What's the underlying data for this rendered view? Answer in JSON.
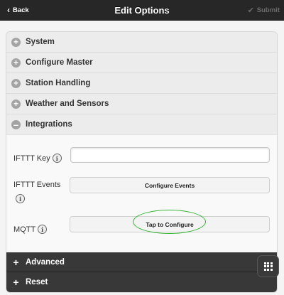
{
  "header": {
    "title": "Edit Options",
    "back_label": "Back",
    "submit_label": "Submit"
  },
  "sections": [
    {
      "label": "System",
      "state": "collapsed"
    },
    {
      "label": "Configure Master",
      "state": "collapsed"
    },
    {
      "label": "Station Handling",
      "state": "collapsed"
    },
    {
      "label": "Weather and Sensors",
      "state": "collapsed"
    },
    {
      "label": "Integrations",
      "state": "expanded"
    },
    {
      "label": "Advanced",
      "state": "collapsed"
    },
    {
      "label": "Reset",
      "state": "collapsed"
    }
  ],
  "integrations": {
    "ifttt_key_label": "IFTTT Key",
    "ifttt_key_value": "",
    "ifttt_events_label": "IFTTT Events",
    "configure_events_label": "Configure Events",
    "mqtt_label": "MQTT",
    "tap_to_configure_label": "Tap to Configure"
  },
  "icons": {
    "info": "info-icon",
    "expand": "plus-icon",
    "collapse": "minus-icon",
    "menu": "grid-icon"
  },
  "colors": {
    "header_bg": "#272727",
    "dark_section_bg": "#383838",
    "highlight_ring": "#2fb52f"
  }
}
